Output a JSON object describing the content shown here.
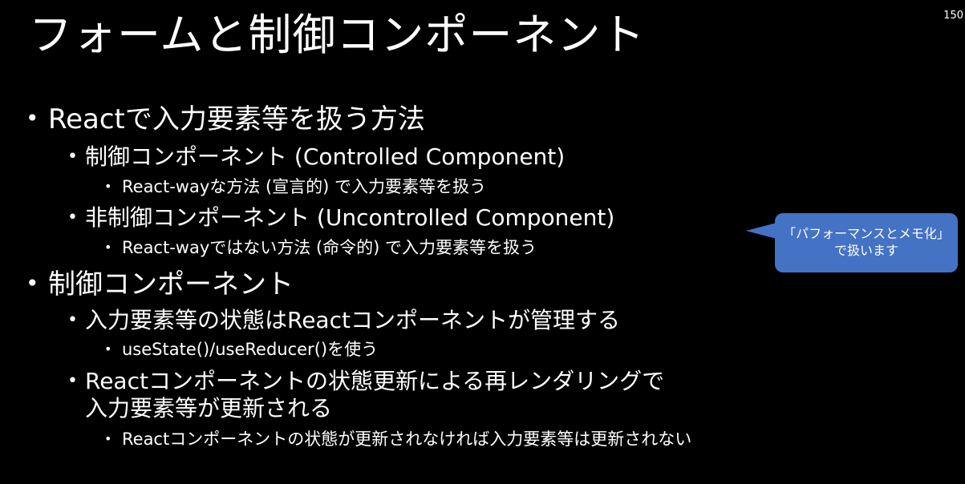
{
  "slide": {
    "page_number": "150",
    "title": "フォームと制御コンポーネント",
    "bullets": [
      {
        "text": "Reactで入力要素等を扱う方法"
      },
      {
        "text": "制御コンポーネント (Controlled Component)"
      },
      {
        "text": "React-wayな方法 (宣言的) で入力要素等を扱う"
      },
      {
        "text": "非制御コンポーネント (Uncontrolled Component)"
      },
      {
        "text": "React-wayではない方法 (命令的) で入力要素等を扱う"
      },
      {
        "text": "制御コンポーネント"
      },
      {
        "text": "入力要素等の状態はReactコンポーネントが管理する"
      },
      {
        "text": "useState()/useReducer()を使う"
      },
      {
        "text": "Reactコンポーネントの状態更新による再レンダリングで"
      },
      {
        "text": "入力要素等が更新される"
      },
      {
        "text": "Reactコンポーネントの状態が更新されなければ入力要素等は更新されない"
      }
    ],
    "callout": {
      "line1": "「パフォーマンスとメモ化」",
      "line2": "で扱います",
      "color": "#4472c4"
    },
    "bullet_glyph": "•"
  }
}
